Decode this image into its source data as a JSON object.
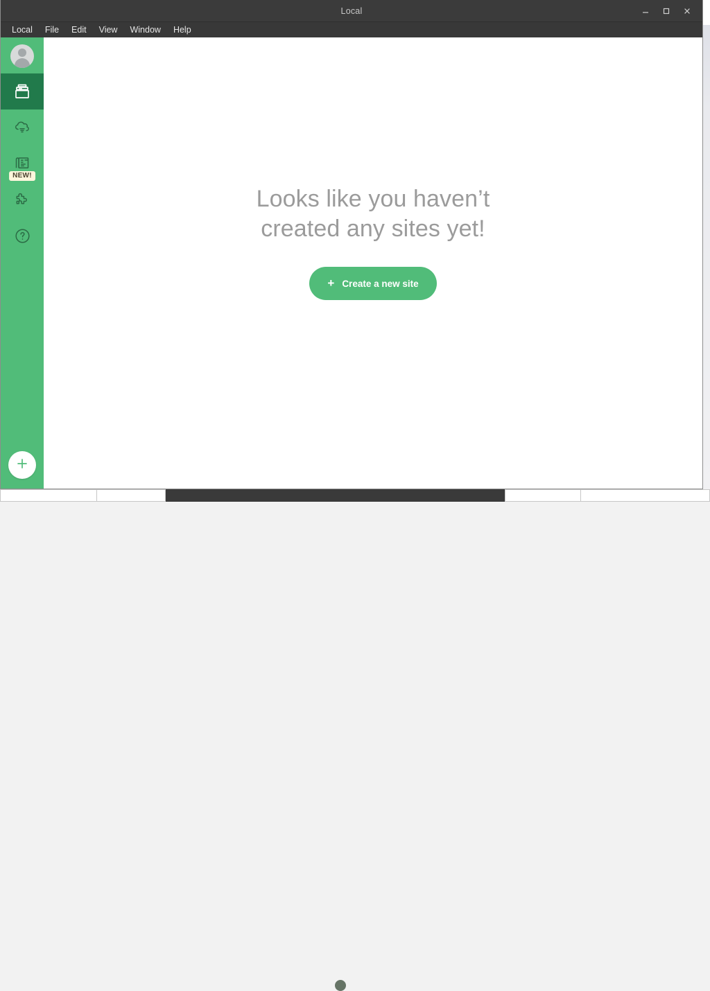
{
  "window": {
    "title": "Local",
    "controls": [
      {
        "name": "minimize",
        "glyph": "minimize-icon"
      },
      {
        "name": "maximize",
        "glyph": "maximize-icon"
      },
      {
        "name": "close",
        "glyph": "close-icon"
      }
    ]
  },
  "menubar": {
    "items": [
      {
        "label": "Local"
      },
      {
        "label": "File"
      },
      {
        "label": "Edit"
      },
      {
        "label": "View"
      },
      {
        "label": "Window"
      },
      {
        "label": "Help"
      }
    ]
  },
  "sidebar": {
    "background_color": "#51bc79",
    "active_color": "#217a4b",
    "items": [
      {
        "name": "account-avatar",
        "icon": "user-avatar-icon",
        "active": false
      },
      {
        "name": "sites",
        "icon": "drawer-icon",
        "active": true
      },
      {
        "name": "cloud-backups",
        "icon": "cloud-download-icon",
        "active": false
      },
      {
        "name": "blueprints",
        "icon": "blueprint-icon",
        "active": false,
        "badge": "NEW!"
      },
      {
        "name": "add-ons",
        "icon": "puzzle-piece-icon",
        "active": false
      },
      {
        "name": "help",
        "icon": "question-circle-icon",
        "active": false
      }
    ],
    "add_button": {
      "name": "add-site",
      "icon": "plus-icon"
    }
  },
  "main": {
    "empty_state": {
      "heading": "Looks like you haven’t\ncreated any sites yet!",
      "heading_color": "#9b9b9b",
      "button_label": "Create a new site",
      "button_icon": "plus-icon",
      "button_color": "#51bc79"
    }
  }
}
